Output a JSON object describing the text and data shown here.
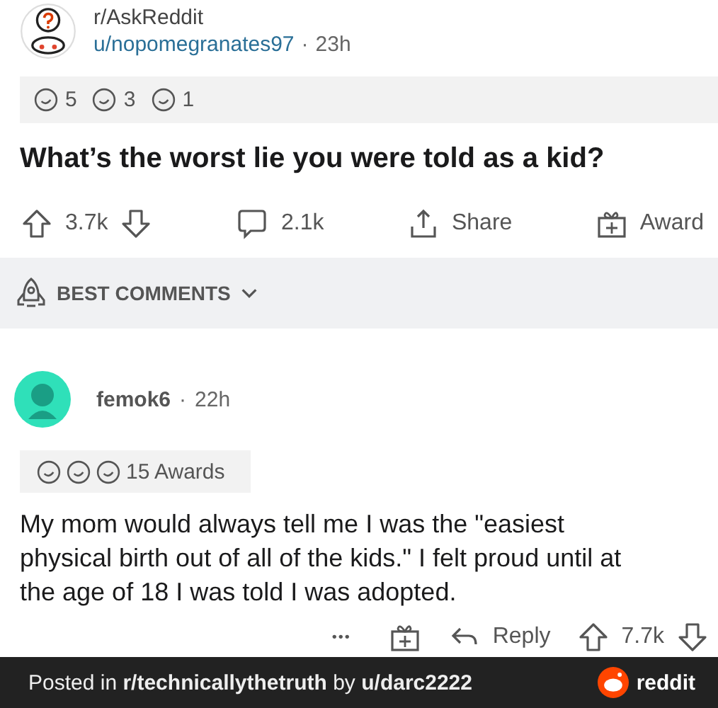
{
  "post": {
    "subreddit": "r/AskReddit",
    "user": "u/nopomegranates97",
    "separator": "·",
    "time": "23h",
    "awards": [
      {
        "count": "5"
      },
      {
        "count": "3"
      },
      {
        "count": "1"
      }
    ],
    "title": "What’s the worst lie you were told as a kid?",
    "votes": "3.7k",
    "comments": "2.1k",
    "share": "Share",
    "award": "Award"
  },
  "sort": {
    "label": "BEST COMMENTS"
  },
  "comment": {
    "author": "femok6",
    "separator": "·",
    "time": "22h",
    "awards_label": "15 Awards",
    "body": "My mom would always tell me I was the \"easiest physical birth out of all of the kids.\" I felt proud until at the age of 18 I was told I was adopted.",
    "more": "•••",
    "reply": "Reply",
    "votes": "7.7k"
  },
  "footer": {
    "text": "Posted in **r/technicallythetruth** by **u/darc2222**",
    "brand": "reddit"
  }
}
